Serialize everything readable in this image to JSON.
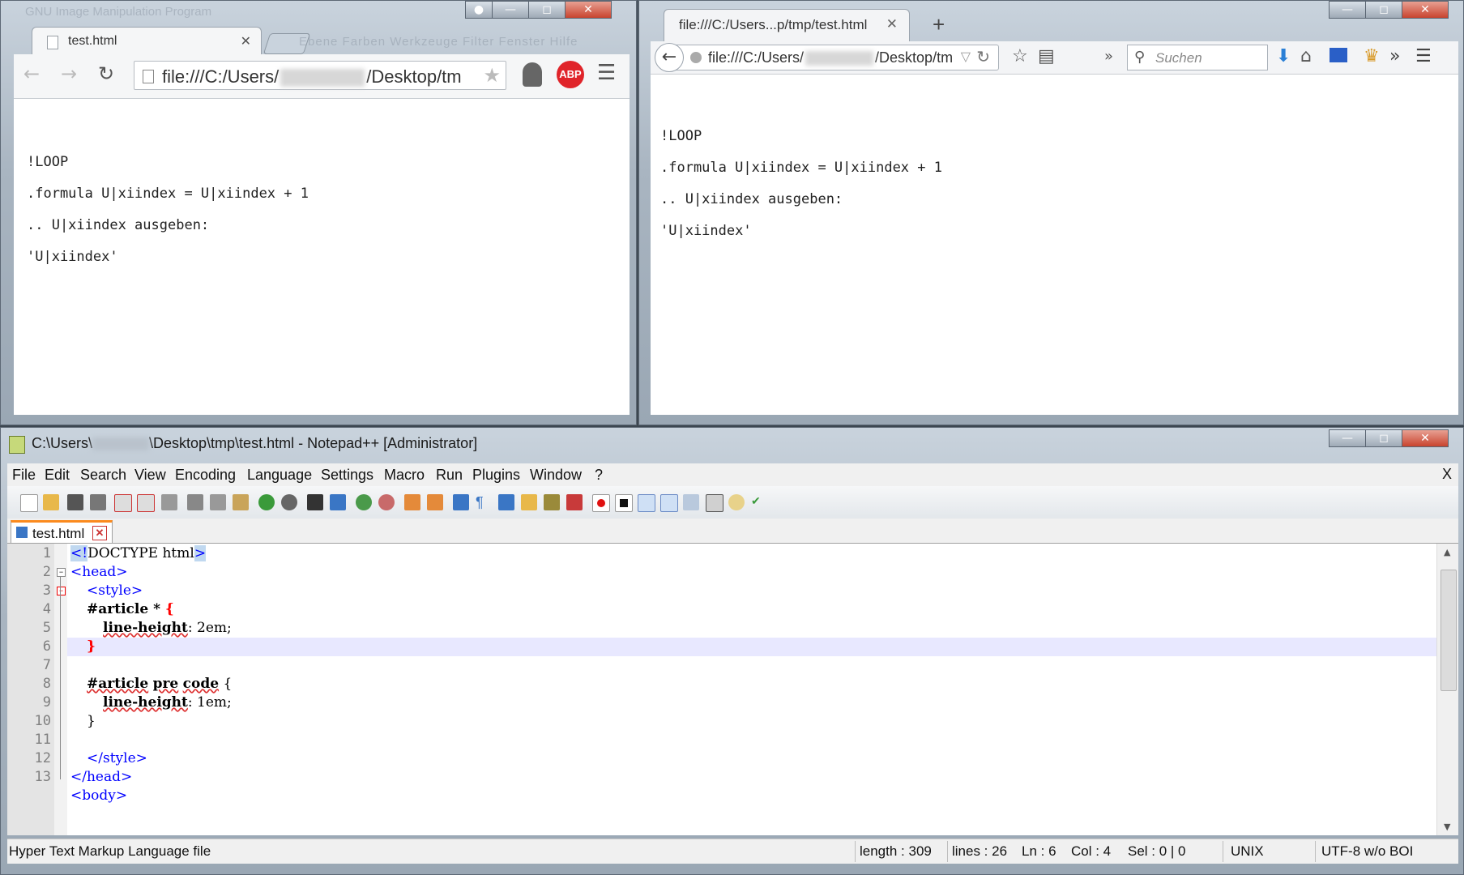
{
  "chrome": {
    "window_title": "GNU Image Manipulation Program",
    "tab_label": "test.html",
    "background_menu": "Ebene  Farben  Werkzeuge  Filter  Fenster  Hilfe",
    "url_prefix": "file:///C:/Users/",
    "url_suffix": "/Desktop/tm",
    "lines": [
      "!LOOP",
      ".formula U|xiindex = U|xiindex + 1",
      ".. U|xiindex ausgeben:",
      "'U|xiindex'"
    ]
  },
  "firefox": {
    "tab_label": "file:///C:/Users...p/tmp/test.html",
    "url_prefix": "file:///C:/Users/",
    "url_suffix": "/Desktop/tm",
    "search_placeholder": "Suchen",
    "lines": [
      "!LOOP",
      ".formula U|xiindex = U|xiindex + 1",
      ".. U|xiindex ausgeben:",
      "'U|xiindex'"
    ]
  },
  "npp": {
    "title_prefix": "C:\\Users\\",
    "title_suffix": "\\Desktop\\tmp\\test.html - Notepad++ [Administrator]",
    "menu": [
      "File",
      "Edit",
      "Search",
      "View",
      "Encoding",
      "Language",
      "Settings",
      "Macro",
      "Run",
      "Plugins",
      "Window",
      "?"
    ],
    "menu_close": "X",
    "file_tab": "test.html",
    "line_numbers": [
      "1",
      "2",
      "3",
      "4",
      "5",
      "6",
      "7",
      "8",
      "9",
      "10",
      "11",
      "12",
      "13"
    ],
    "code": {
      "l1_a": "<!",
      "l1_b": "DOCTYPE html",
      "l1_c": ">",
      "l2": "<head>",
      "l3": "<style>",
      "l4_sel": "#article",
      "l4_star": " * ",
      "l4_brace": "{",
      "l5_prop": "line-height",
      "l5_val": ": 2em;",
      "l6": "}",
      "l8_a": "#article",
      "l8_b": "pre",
      "l8_c": "code",
      "l8_d": " {",
      "l9_prop": "line-height",
      "l9_val": ": 1em;",
      "l10": "}",
      "l12": "</style>",
      "l13": "</head>",
      "l14": "<body>"
    },
    "status": {
      "filetype": "Hyper Text Markup Language file",
      "length": "length : 309",
      "lines": "lines : 26",
      "ln": "Ln : 6",
      "col": "Col : 4",
      "sel": "Sel : 0 | 0",
      "eol": "UNIX",
      "encoding": "UTF-8 w/o BOI"
    }
  },
  "colors": {
    "npp_tag": "#0000ff",
    "npp_brace": "#ff0000",
    "npp_tab_accent": "#fb8a1e",
    "abp_red": "#e0242a"
  },
  "icons": [
    "back-arrow-icon",
    "forward-arrow-icon",
    "reload-icon",
    "star-icon",
    "ghost-icon",
    "abp-icon",
    "menu-icon",
    "search-icon",
    "download-icon",
    "home-icon"
  ]
}
